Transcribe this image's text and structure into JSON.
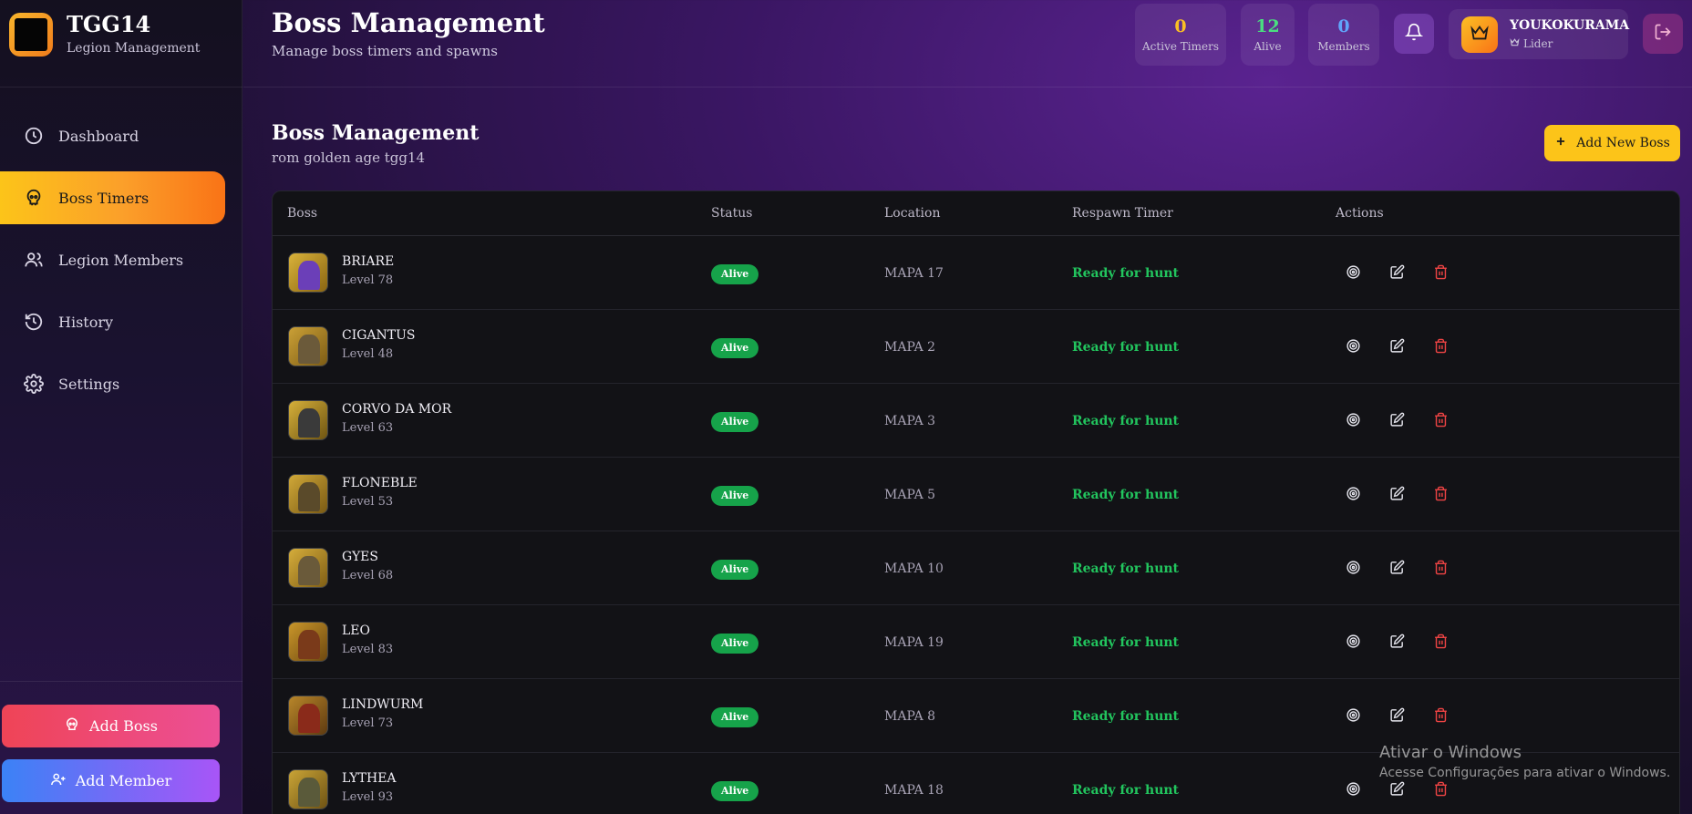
{
  "brand": {
    "name": "TGG14",
    "subtitle": "Legion Management"
  },
  "nav": [
    {
      "label": "Dashboard",
      "icon": "clock-icon"
    },
    {
      "label": "Boss Timers",
      "icon": "skull-icon",
      "active": true
    },
    {
      "label": "Legion Members",
      "icon": "users-icon"
    },
    {
      "label": "History",
      "icon": "history-icon"
    },
    {
      "label": "Settings",
      "icon": "gear-icon"
    }
  ],
  "sidebar_actions": {
    "add_boss": "Add Boss",
    "add_member": "Add Member"
  },
  "header": {
    "title": "Boss Management",
    "subtitle": "Manage boss timers and spawns",
    "stats": [
      {
        "value": "0",
        "label": "Active Timers",
        "color": "#fbbf24"
      },
      {
        "value": "12",
        "label": "Alive",
        "color": "#4ade80"
      },
      {
        "value": "0",
        "label": "Members",
        "color": "#60a5fa"
      }
    ],
    "user": {
      "name": "YOUKOKURAMA",
      "role": "Lider"
    }
  },
  "section": {
    "title": "Boss Management",
    "subtitle": "rom golden age tgg14",
    "add_button": "Add New Boss"
  },
  "table": {
    "columns": [
      "Boss",
      "Status",
      "Location",
      "Respawn Timer",
      "Actions"
    ],
    "rows": [
      {
        "name": "BRIARE",
        "level": "Level 78",
        "status": "Alive",
        "location": "MAPA 17",
        "respawn": "Ready for hunt"
      },
      {
        "name": "CIGANTUS",
        "level": "Level 48",
        "status": "Alive",
        "location": "MAPA 2",
        "respawn": "Ready for hunt"
      },
      {
        "name": "CORVO DA MOR",
        "level": "Level 63",
        "status": "Alive",
        "location": "MAPA 3",
        "respawn": "Ready for hunt"
      },
      {
        "name": "FLONEBLE",
        "level": "Level 53",
        "status": "Alive",
        "location": "MAPA 5",
        "respawn": "Ready for hunt"
      },
      {
        "name": "GYES",
        "level": "Level 68",
        "status": "Alive",
        "location": "MAPA 10",
        "respawn": "Ready for hunt"
      },
      {
        "name": "LEO",
        "level": "Level 83",
        "status": "Alive",
        "location": "MAPA 19",
        "respawn": "Ready for hunt"
      },
      {
        "name": "LINDWURM",
        "level": "Level 73",
        "status": "Alive",
        "location": "MAPA 8",
        "respawn": "Ready for hunt"
      },
      {
        "name": "LYTHEA",
        "level": "Level 93",
        "status": "Alive",
        "location": "MAPA 18",
        "respawn": "Ready for hunt"
      }
    ]
  },
  "watermark": {
    "line1": "Ativar o Windows",
    "line2": "Acesse Configurações para ativar o Windows."
  },
  "colors": {
    "accent": "#fcc419",
    "alive_badge": "#16a34a",
    "ready_text": "#22c55e",
    "delete_icon": "#ef4444"
  }
}
